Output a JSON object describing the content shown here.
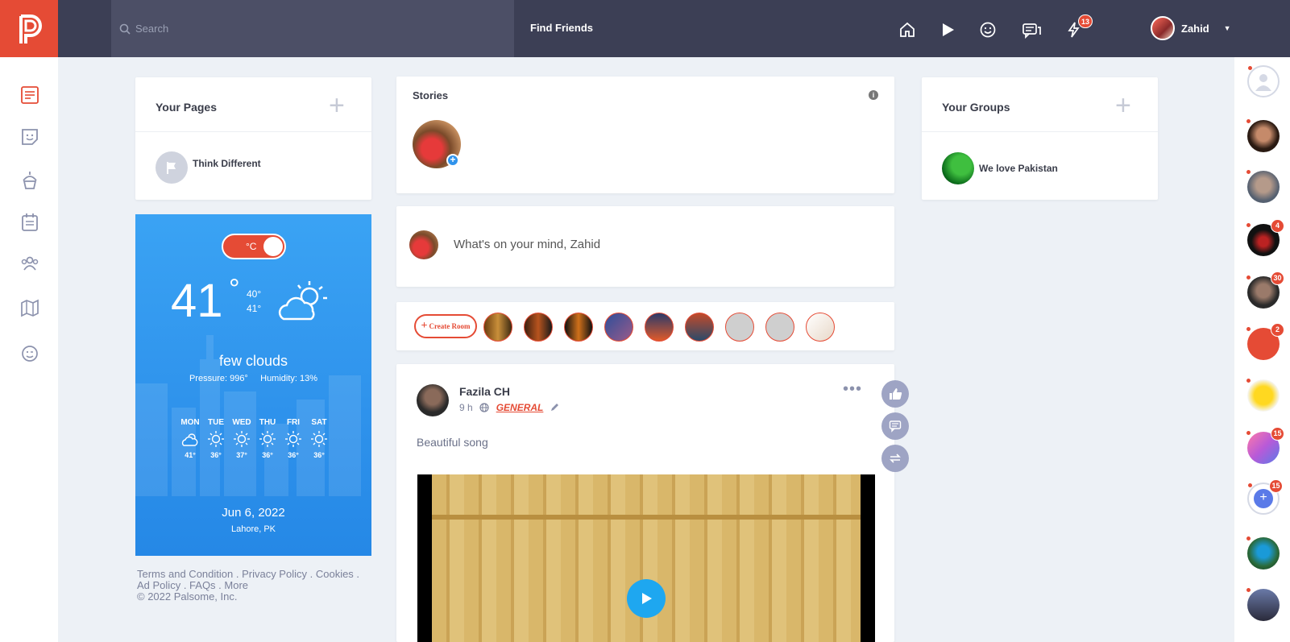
{
  "topbar": {
    "search_placeholder": "Search",
    "find_friends": "Find Friends",
    "notifications_badge": "13",
    "user_name": "Zahid"
  },
  "your_pages": {
    "title": "Your Pages",
    "items": [
      {
        "name": "Think Different"
      }
    ]
  },
  "weather": {
    "unit_toggle": "°C",
    "temp": "41",
    "deg": "°",
    "high": "40°",
    "low": "41°",
    "description": "few clouds",
    "pressure": "Pressure: 996°",
    "humidity": "Humidity: 13%",
    "forecast": [
      {
        "day": "MON",
        "temp": "41°",
        "icon": "cloud-sun-icon"
      },
      {
        "day": "TUE",
        "temp": "36°",
        "icon": "sun-icon"
      },
      {
        "day": "WED",
        "temp": "37°",
        "icon": "sun-icon"
      },
      {
        "day": "THU",
        "temp": "36°",
        "icon": "sun-icon"
      },
      {
        "day": "FRI",
        "temp": "36°",
        "icon": "sun-icon"
      },
      {
        "day": "SAT",
        "temp": "36°",
        "icon": "sun-icon"
      }
    ],
    "date": "Jun 6, 2022",
    "location": "Lahore, PK"
  },
  "footer": {
    "terms": "Terms and Condition",
    "privacy": "Privacy Policy",
    "cookies": "Cookies",
    "ad_policy": "Ad Policy",
    "faqs": "FAQs",
    "more": "More",
    "copyright": "© 2022 Palsome, Inc.",
    "sep": " . "
  },
  "stories": {
    "title": "Stories"
  },
  "composer": {
    "placeholder": "What's on your mind, Zahid"
  },
  "rooms": {
    "create_label": "Create Room"
  },
  "post": {
    "author": "Fazila CH",
    "time": "9 h",
    "category": "GENERAL",
    "text": "Beautiful song"
  },
  "your_groups": {
    "title": "Your Groups",
    "items": [
      {
        "name": "We love Pakistan"
      }
    ]
  },
  "contacts": {
    "badges": [
      "",
      "",
      "",
      "4",
      "30",
      "2",
      "",
      "15",
      "15",
      "",
      ""
    ]
  },
  "colors": {
    "brand": "#e54b35",
    "topbar": "#3c3f55",
    "weather_blue": "#2f93ec",
    "link_orange": "#e54b35"
  }
}
